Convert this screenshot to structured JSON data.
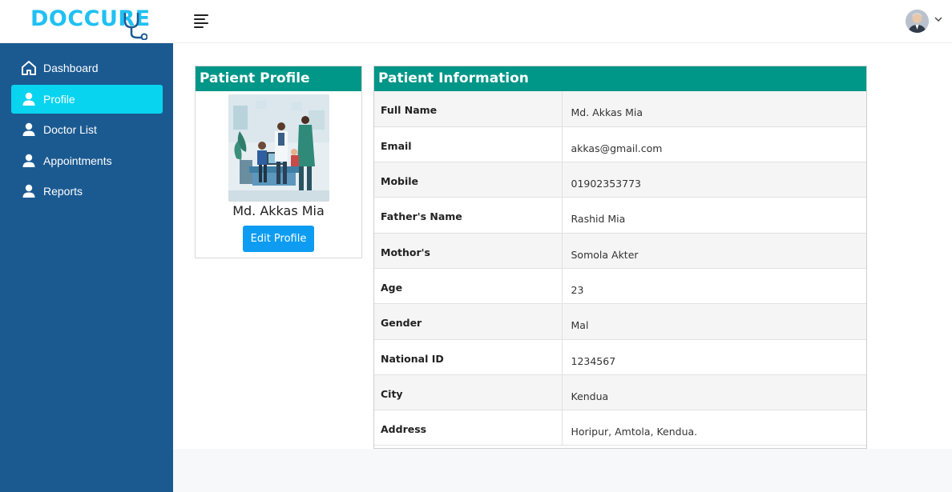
{
  "header": {
    "logo_text": "DOCCURE",
    "menu_icon": "hamburger-icon",
    "user_avatar": "avatar",
    "user_menu_icon": "chevron-down-icon"
  },
  "sidebar": {
    "items": [
      {
        "label": "Dashboard",
        "icon": "home-icon",
        "active": false
      },
      {
        "label": "Profile",
        "icon": "user-icon",
        "active": true
      },
      {
        "label": "Doctor List",
        "icon": "user-icon",
        "active": false
      },
      {
        "label": "Appointments",
        "icon": "user-icon",
        "active": false
      },
      {
        "label": "Reports",
        "icon": "user-icon",
        "active": false
      }
    ]
  },
  "profile_card": {
    "title": "Patient Profile",
    "name": "Md. Akkas Mia",
    "edit_label": "Edit Profile"
  },
  "info_card": {
    "title": "Patient Information",
    "rows": [
      {
        "key": "Full Name",
        "value": "Md. Akkas Mia"
      },
      {
        "key": "Email",
        "value": "akkas@gmail.com"
      },
      {
        "key": "Mobile",
        "value": "01902353773"
      },
      {
        "key": "Father's Name",
        "value": "Rashid Mia"
      },
      {
        "key": "Mothor's",
        "value": "Somola Akter"
      },
      {
        "key": "Age",
        "value": "23"
      },
      {
        "key": "Gender",
        "value": "Mal"
      },
      {
        "key": "National ID",
        "value": "1234567"
      },
      {
        "key": "City",
        "value": "Kendua"
      },
      {
        "key": "Address",
        "value": "Horipur, Amtola, Kendua."
      }
    ]
  },
  "colors": {
    "sidebar_bg": "#1b5a91",
    "active_item": "#09d4f0",
    "card_header": "#009688",
    "button": "#0d9cf1",
    "logo": "#20c0f3"
  }
}
